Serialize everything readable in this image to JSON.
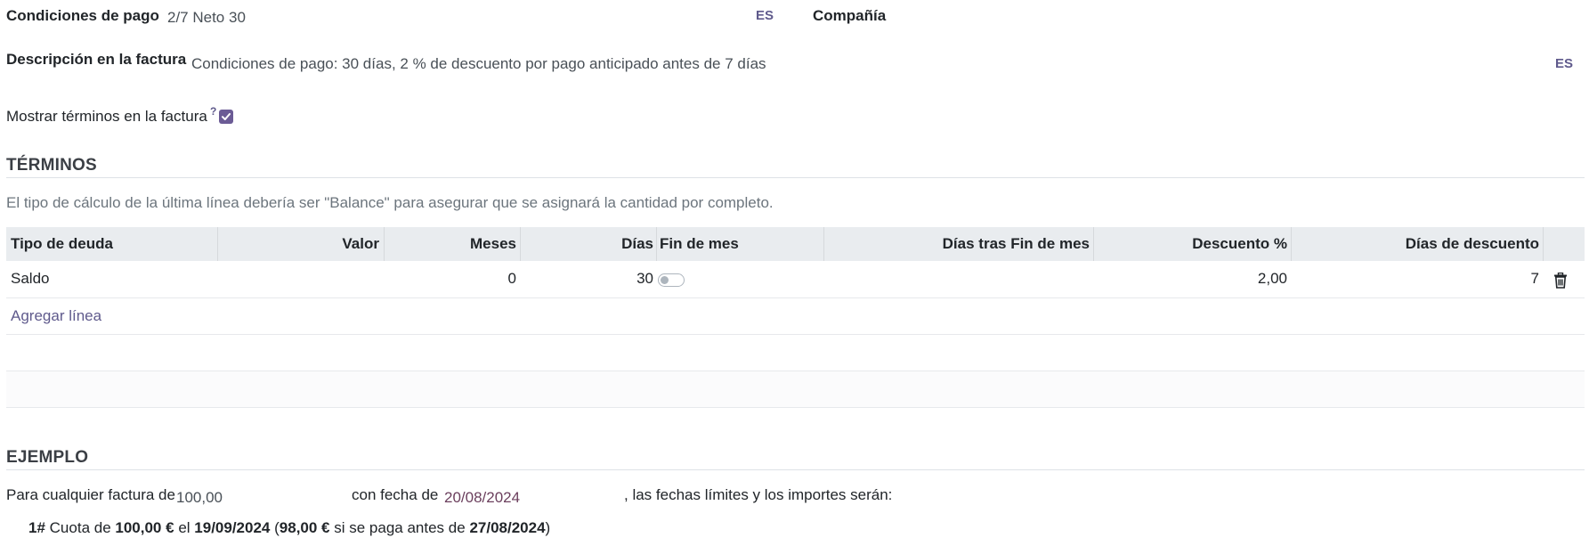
{
  "fields": {
    "payment_terms_label": "Condiciones de pago",
    "payment_terms_value": "2/7 Neto 30",
    "payment_terms_lang": "ES",
    "company_label": "Compañía",
    "invoice_description_label": "Descripción en la factura",
    "invoice_description_value": "Condiciones de pago: 30 días, 2 % de descuento por pago anticipado antes de 7 días",
    "invoice_description_lang": "ES",
    "show_terms_label": "Mostrar términos en la factura",
    "show_terms_help": "?",
    "show_terms_checked": true
  },
  "terms": {
    "title": "TÉRMINOS",
    "note": "El tipo de cálculo de la última línea debería ser \"Balance\" para asegurar que se asignará la cantidad por completo.",
    "columns": [
      "Tipo de deuda",
      "Valor",
      "Meses",
      "Días",
      "Fin de mes",
      "Días tras Fin de mes",
      "Descuento %",
      "Días de descuento"
    ],
    "rows": [
      {
        "tipo": "Saldo",
        "valor": "",
        "meses": "0",
        "dias": "30",
        "fin_de_mes": false,
        "dias_tras_fin": "",
        "descuento": "2,00",
        "dias_descuento": "7"
      }
    ],
    "add_line": "Agregar línea"
  },
  "example": {
    "title": "EJEMPLO",
    "prefix": "Para cualquier factura de",
    "amount": "100,00",
    "date_label": "con fecha de",
    "date": "20/08/2024",
    "suffix": ", las fechas límites y los importes serán:",
    "line": {
      "num": "1#",
      "t1": "Cuota de",
      "amount": "100,00 €",
      "t2": "el",
      "date": "19/09/2024",
      "t3": "(",
      "disc_amount": "98,00 €",
      "t4": "si se paga antes de",
      "disc_date": "27/08/2024",
      "t5": ")"
    }
  },
  "colors": {
    "accent": "#6b5b95",
    "header_bg": "#e9ecef",
    "date": "#6b3f5d"
  }
}
